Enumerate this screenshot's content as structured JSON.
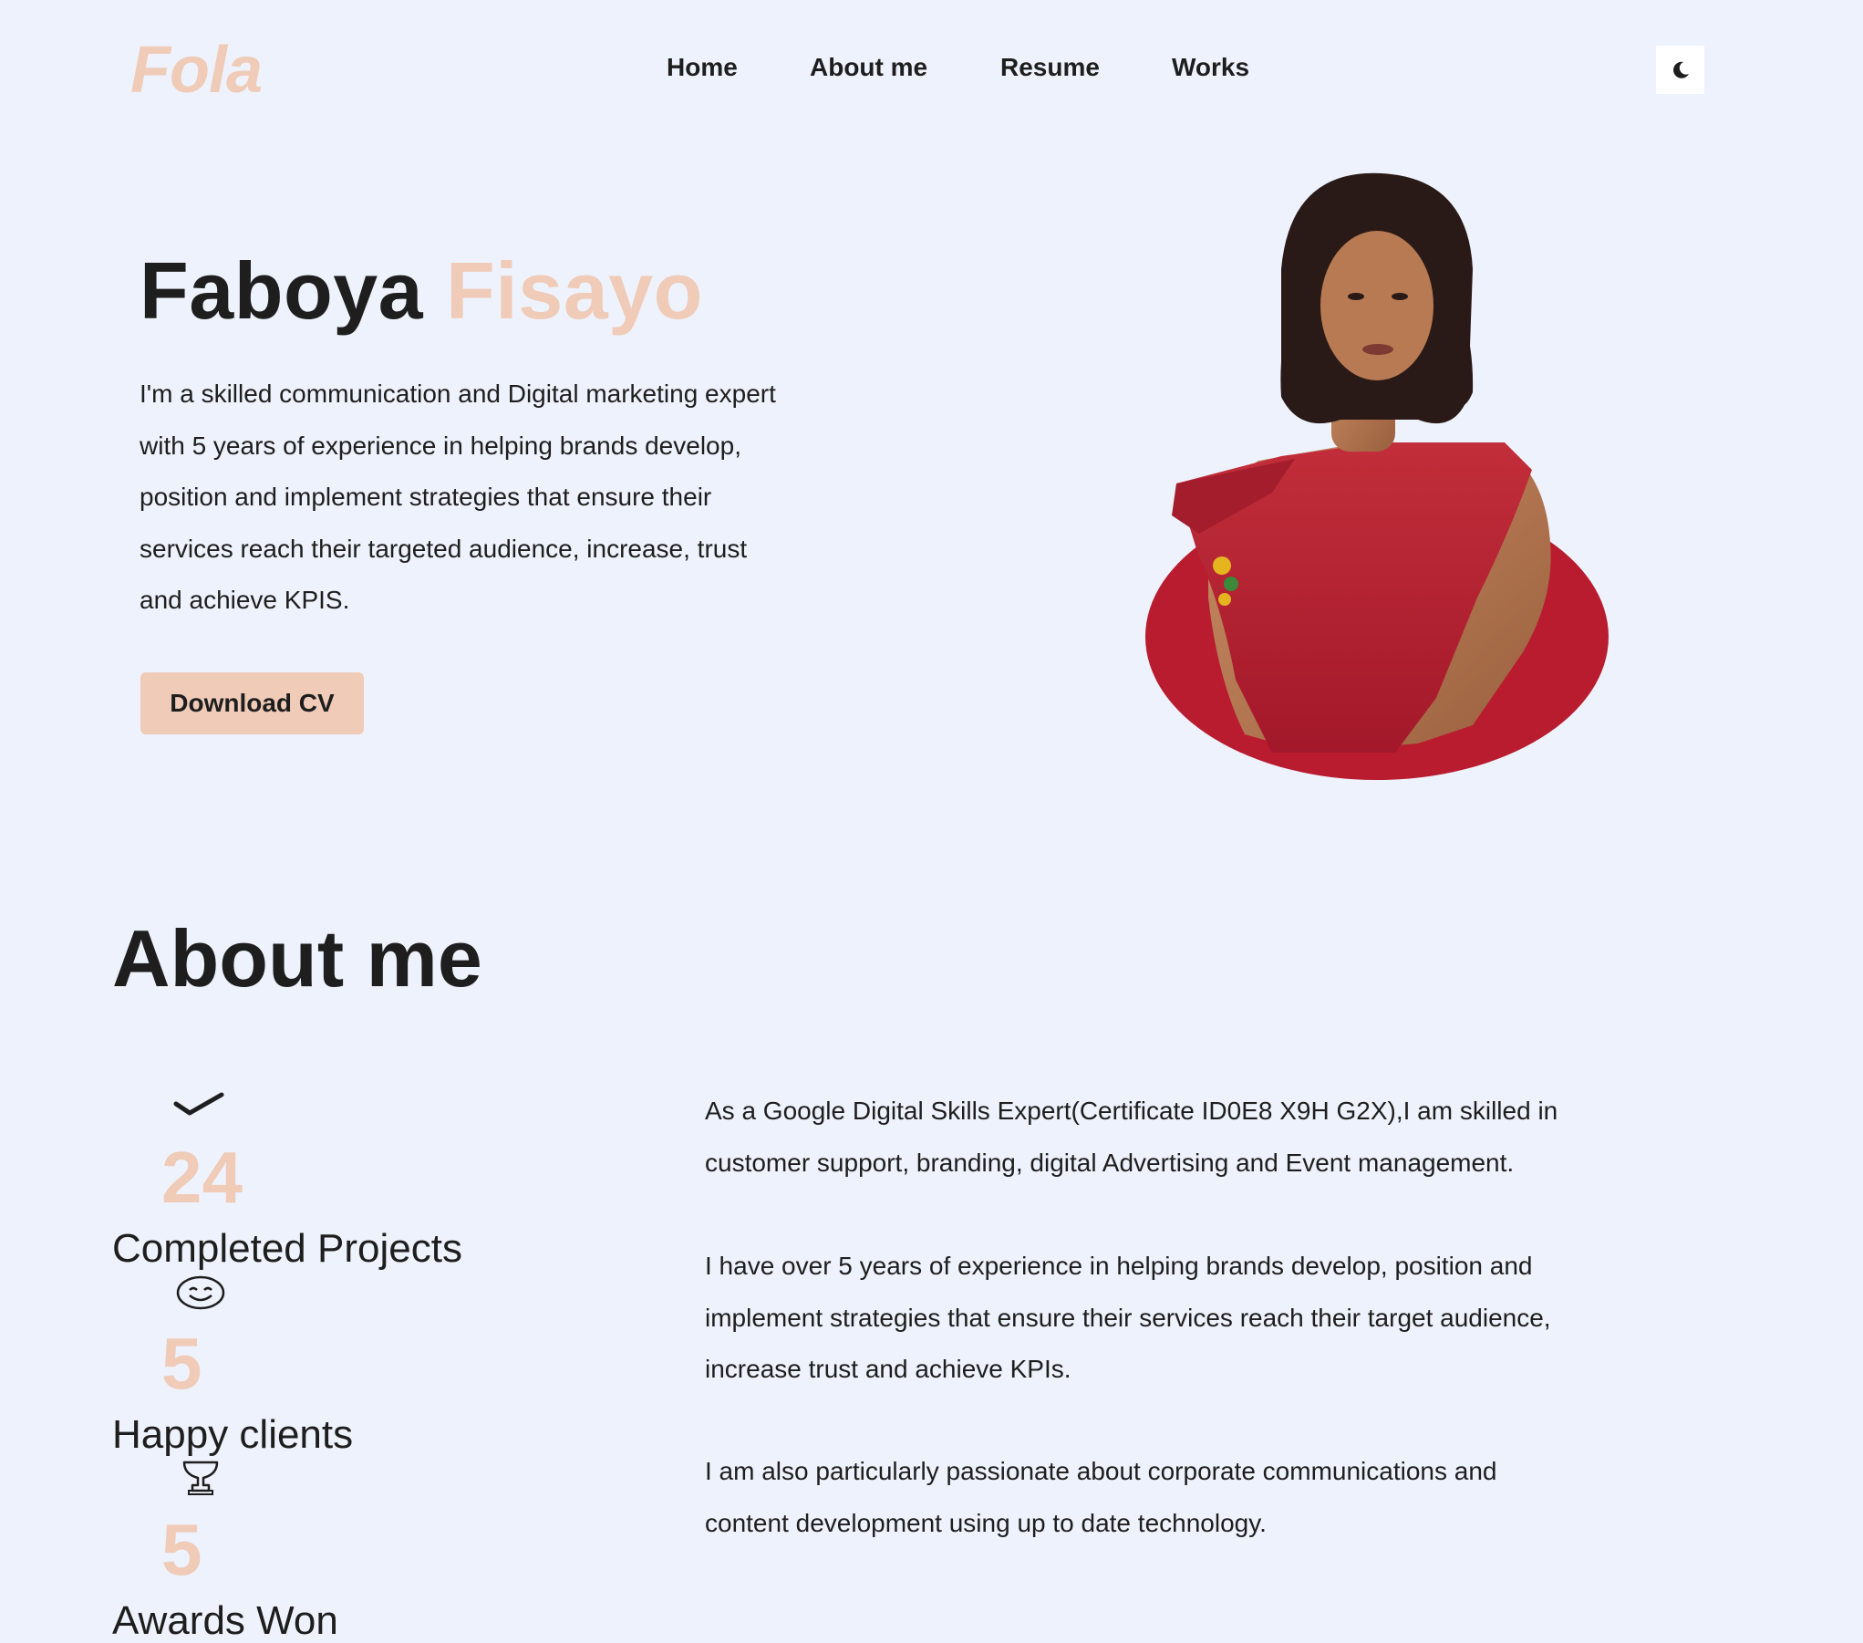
{
  "header": {
    "logo": "Fola",
    "nav": [
      "Home",
      "About me",
      "Resume",
      "Works"
    ],
    "theme_toggle_icon": "moon-icon"
  },
  "hero": {
    "first_name": "Faboya",
    "last_name": "Fisayo",
    "description": "I'm a skilled communication and Digital marketing expert with 5 years of experience in helping brands develop, position and implement strategies that ensure their services reach their targeted audience, increase, trust and achieve KPIS.",
    "cta_label": "Download CV",
    "portrait_alt_icon": "portrait-photo"
  },
  "about": {
    "title": "About me",
    "stats": [
      {
        "icon": "checkmark-icon",
        "value": "24",
        "label": "Completed Projects"
      },
      {
        "icon": "smiley-icon",
        "value": "5",
        "label": "Happy clients"
      },
      {
        "icon": "trophy-icon",
        "value": "5",
        "label": "Awards Won"
      }
    ],
    "paragraphs": [
      "As a Google Digital Skills Expert(Certificate ID0E8 X9H G2X),I am skilled in customer support, branding, digital Advertising and Event management.",
      "I have over 5 years of experience in helping brands develop, position and implement strategies that ensure their services reach their target audience, increase trust and achieve KPIs.",
      "I am also particularly passionate about corporate communications and content development using up to date technology."
    ]
  },
  "colors": {
    "background": "#eef2fc",
    "accent": "#efcbb8",
    "text": "#1e1e1e",
    "dress_red": "#b81c2e"
  }
}
